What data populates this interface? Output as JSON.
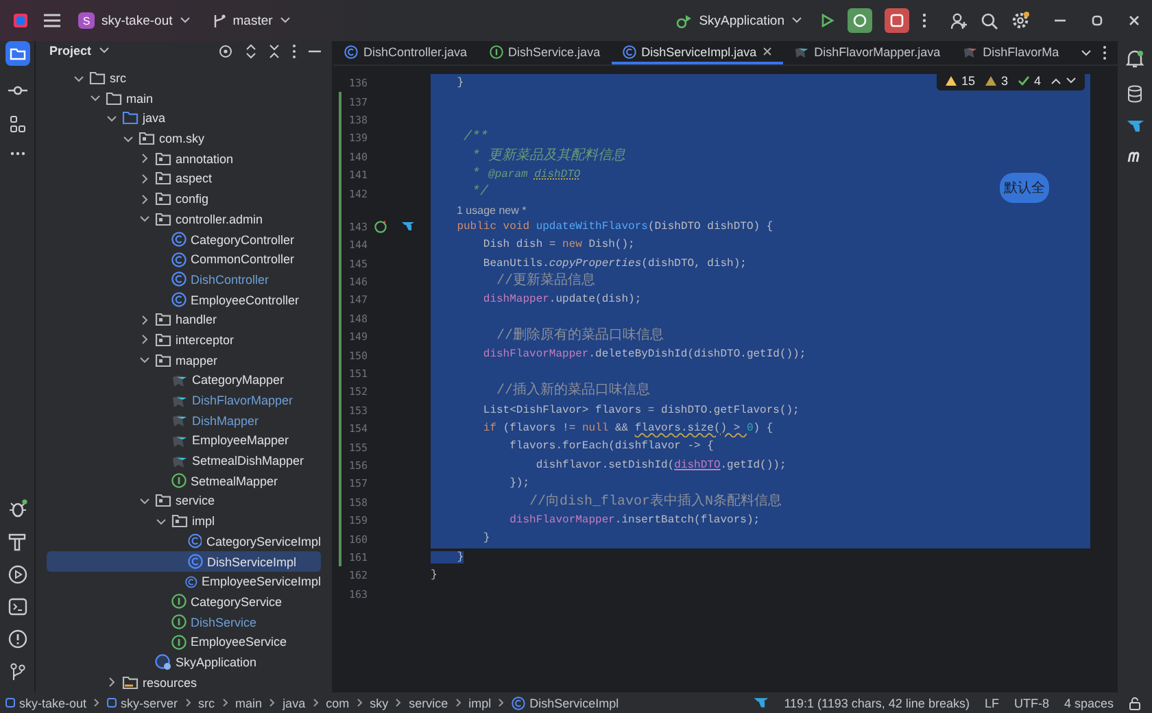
{
  "toolbar": {
    "project_badge": "S",
    "project": "sky-take-out",
    "branch": "master",
    "run_config": "SkyApplication"
  },
  "project_panel": {
    "title": "Project"
  },
  "tree": [
    {
      "label": "src",
      "kind": "folder",
      "expanded": true,
      "modified": false,
      "selected": false,
      "children": [
        {
          "label": "main",
          "kind": "folder",
          "expanded": true,
          "modified": false,
          "selected": false,
          "children": [
            {
              "label": "java",
              "kind": "source",
              "expanded": true,
              "modified": false,
              "selected": false,
              "children": [
                {
                  "label": "com.sky",
                  "kind": "package",
                  "expanded": true,
                  "modified": false,
                  "selected": false,
                  "children": [
                    {
                      "label": "annotation",
                      "kind": "package",
                      "expanded": false,
                      "modified": false,
                      "selected": false
                    },
                    {
                      "label": "aspect",
                      "kind": "package",
                      "expanded": false,
                      "modified": false,
                      "selected": false
                    },
                    {
                      "label": "config",
                      "kind": "package",
                      "expanded": false,
                      "modified": false,
                      "selected": false
                    },
                    {
                      "label": "controller.admin",
                      "kind": "package",
                      "expanded": true,
                      "modified": false,
                      "selected": false,
                      "children": [
                        {
                          "label": "CategoryController",
                          "kind": "class",
                          "modified": false,
                          "selected": false
                        },
                        {
                          "label": "CommonController",
                          "kind": "class",
                          "modified": false,
                          "selected": false
                        },
                        {
                          "label": "DishController",
                          "kind": "class",
                          "modified": true,
                          "selected": false
                        },
                        {
                          "label": "EmployeeController",
                          "kind": "class",
                          "modified": false,
                          "selected": false
                        }
                      ]
                    },
                    {
                      "label": "handler",
                      "kind": "package",
                      "expanded": false,
                      "modified": false,
                      "selected": false
                    },
                    {
                      "label": "interceptor",
                      "kind": "package",
                      "expanded": false,
                      "modified": false,
                      "selected": false
                    },
                    {
                      "label": "mapper",
                      "kind": "package",
                      "expanded": true,
                      "modified": false,
                      "selected": false,
                      "children": [
                        {
                          "label": "CategoryMapper",
                          "kind": "mapper",
                          "modified": false,
                          "selected": false
                        },
                        {
                          "label": "DishFlavorMapper",
                          "kind": "mapper",
                          "modified": true,
                          "selected": false
                        },
                        {
                          "label": "DishMapper",
                          "kind": "mapper",
                          "modified": true,
                          "selected": false
                        },
                        {
                          "label": "EmployeeMapper",
                          "kind": "mapper",
                          "modified": false,
                          "selected": false
                        },
                        {
                          "label": "SetmealDishMapper",
                          "kind": "mapper",
                          "modified": false,
                          "selected": false
                        },
                        {
                          "label": "SetmealMapper",
                          "kind": "interface",
                          "modified": false,
                          "selected": false
                        }
                      ]
                    },
                    {
                      "label": "service",
                      "kind": "package",
                      "expanded": true,
                      "modified": false,
                      "selected": false,
                      "children": [
                        {
                          "label": "impl",
                          "kind": "package",
                          "expanded": true,
                          "modified": false,
                          "selected": false,
                          "children": [
                            {
                              "label": "CategoryServiceImpl",
                              "kind": "class",
                              "modified": false,
                              "selected": false
                            },
                            {
                              "label": "DishServiceImpl",
                              "kind": "class",
                              "modified": false,
                              "selected": true
                            },
                            {
                              "label": "EmployeeServiceImpl",
                              "kind": "class",
                              "modified": false,
                              "selected": false
                            }
                          ]
                        },
                        {
                          "label": "CategoryService",
                          "kind": "interface",
                          "modified": false,
                          "selected": false
                        },
                        {
                          "label": "DishService",
                          "kind": "interface",
                          "modified": true,
                          "selected": false
                        },
                        {
                          "label": "EmployeeService",
                          "kind": "interface",
                          "modified": false,
                          "selected": false
                        }
                      ]
                    },
                    {
                      "label": "SkyApplication",
                      "kind": "app",
                      "modified": false,
                      "selected": false
                    }
                  ]
                }
              ]
            },
            {
              "label": "resources",
              "kind": "resources",
              "expanded": false,
              "modified": false,
              "selected": false
            }
          ]
        }
      ]
    }
  ],
  "tabs": [
    {
      "label": "DishController.java",
      "kind": "class",
      "selected": false,
      "closable": false
    },
    {
      "label": "DishService.java",
      "kind": "interface",
      "selected": false,
      "closable": false
    },
    {
      "label": "DishServiceImpl.java",
      "kind": "class",
      "selected": true,
      "closable": true
    },
    {
      "label": "DishFlavorMapper.java",
      "kind": "mapper",
      "selected": false,
      "closable": false
    },
    {
      "label": "DishFlavorMa",
      "kind": "mapper-xml",
      "selected": false,
      "closable": false
    }
  ],
  "inspections": [
    {
      "kind": "warning",
      "count": "15"
    },
    {
      "kind": "weak",
      "count": "3"
    },
    {
      "kind": "ok",
      "count": "4"
    }
  ],
  "hint_bubble": "默认全",
  "lines": [
    {
      "kind": "code",
      "number": "136",
      "selected": true,
      "changed": false,
      "tokens": [
        {
          "kind": "plain",
          "text": "    }"
        }
      ]
    },
    {
      "kind": "code",
      "number": "137",
      "selected": true,
      "changed": true
    },
    {
      "kind": "code",
      "number": "138",
      "selected": true,
      "changed": true
    },
    {
      "kind": "code",
      "number": "139",
      "selected": true,
      "changed": true,
      "tokens": [
        {
          "kind": "doc",
          "text": "    /**"
        }
      ]
    },
    {
      "kind": "code",
      "number": "140",
      "selected": true,
      "changed": true,
      "tokens": [
        {
          "kind": "doc",
          "text": "     * 更新菜品及其配料信息"
        }
      ]
    },
    {
      "kind": "code",
      "number": "141",
      "selected": true,
      "changed": true,
      "tokens": [
        {
          "kind": "doc",
          "text": "     * "
        },
        {
          "kind": "doctag",
          "text": "@param "
        },
        {
          "kind": "docref",
          "text": "dishDTO"
        }
      ]
    },
    {
      "kind": "code",
      "number": "142",
      "selected": true,
      "changed": true,
      "tokens": [
        {
          "kind": "doc",
          "text": "     */"
        }
      ]
    },
    {
      "kind": "inlay",
      "text": "1 usage   new *",
      "selected": true,
      "changed": true
    },
    {
      "kind": "code",
      "number": "143",
      "selected": true,
      "changed": true,
      "gutter_icons": true,
      "tokens": [
        {
          "kind": "kw",
          "text": "    public void "
        },
        {
          "kind": "fn",
          "text": "updateWithFlavors"
        },
        {
          "kind": "plain",
          "text": "(DishDTO dishDTO) {"
        }
      ]
    },
    {
      "kind": "code",
      "number": "144",
      "selected": true,
      "changed": true,
      "tokens": [
        {
          "kind": "plain",
          "text": "        Dish dish = "
        },
        {
          "kind": "kw",
          "text": "new"
        },
        {
          "kind": "plain",
          "text": " Dish();"
        }
      ]
    },
    {
      "kind": "code",
      "number": "145",
      "selected": true,
      "changed": true,
      "tokens": [
        {
          "kind": "plain",
          "text": "        BeanUtils."
        },
        {
          "kind": "static",
          "text": "copyProperties"
        },
        {
          "kind": "plain",
          "text": "(dishDTO, dish);"
        }
      ]
    },
    {
      "kind": "code",
      "number": "146",
      "selected": true,
      "changed": true,
      "tokens": [
        {
          "kind": "comment",
          "text": "        //更新菜品信息"
        }
      ]
    },
    {
      "kind": "code",
      "number": "147",
      "selected": true,
      "changed": true,
      "tokens": [
        {
          "kind": "field",
          "text": "        dishMapper"
        },
        {
          "kind": "plain",
          "text": ".update(dish);"
        }
      ]
    },
    {
      "kind": "code",
      "number": "148",
      "selected": true,
      "changed": true
    },
    {
      "kind": "code",
      "number": "149",
      "selected": true,
      "changed": true,
      "tokens": [
        {
          "kind": "comment",
          "text": "        //删除原有的菜品口味信息"
        }
      ]
    },
    {
      "kind": "code",
      "number": "150",
      "selected": true,
      "changed": true,
      "tokens": [
        {
          "kind": "field",
          "text": "        dishFlavorMapper"
        },
        {
          "kind": "plain",
          "text": ".deleteByDishId(dishDTO.getId());"
        }
      ]
    },
    {
      "kind": "code",
      "number": "151",
      "selected": true,
      "changed": true
    },
    {
      "kind": "code",
      "number": "152",
      "selected": true,
      "changed": true,
      "tokens": [
        {
          "kind": "comment",
          "text": "        //插入新的菜品口味信息"
        }
      ]
    },
    {
      "kind": "code",
      "number": "153",
      "selected": true,
      "changed": true,
      "tokens": [
        {
          "kind": "plain",
          "text": "        List<DishFlavor> flavors = dishDTO.getFlavors();"
        }
      ]
    },
    {
      "kind": "code",
      "number": "154",
      "selected": true,
      "changed": true,
      "tokens": [
        {
          "kind": "kw",
          "text": "        if"
        },
        {
          "kind": "plain",
          "text": " (flavors != "
        },
        {
          "kind": "kw",
          "text": "null"
        },
        {
          "kind": "plain",
          "text": " && "
        },
        {
          "kind": "warn",
          "text": "flavors.size() > "
        },
        {
          "kind": "num",
          "text": "0"
        },
        {
          "kind": "plain",
          "text": ") {"
        }
      ]
    },
    {
      "kind": "code",
      "number": "155",
      "selected": true,
      "changed": true,
      "tokens": [
        {
          "kind": "plain",
          "text": "            flavors.forEach(dishflavor -> {"
        }
      ]
    },
    {
      "kind": "code",
      "number": "156",
      "selected": true,
      "changed": true,
      "tokens": [
        {
          "kind": "plain",
          "text": "                dishflavor.setDishId("
        },
        {
          "kind": "captured",
          "text": "dishDTO"
        },
        {
          "kind": "plain",
          "text": ".getId());"
        }
      ]
    },
    {
      "kind": "code",
      "number": "157",
      "selected": true,
      "changed": true,
      "tokens": [
        {
          "kind": "plain",
          "text": "            });"
        }
      ]
    },
    {
      "kind": "code",
      "number": "158",
      "selected": true,
      "changed": true,
      "tokens": [
        {
          "kind": "comment",
          "text": "            //向dish_flavor表中插入N条配料信息"
        }
      ]
    },
    {
      "kind": "code",
      "number": "159",
      "selected": true,
      "changed": true,
      "tokens": [
        {
          "kind": "field",
          "text": "            dishFlavorMapper"
        },
        {
          "kind": "plain",
          "text": ".insertBatch(flavors);"
        }
      ]
    },
    {
      "kind": "code",
      "number": "160",
      "selected": true,
      "changed": true,
      "tokens": [
        {
          "kind": "plain",
          "text": "        }"
        }
      ]
    },
    {
      "kind": "code",
      "number": "161",
      "selected": false,
      "changed": true,
      "tokens": [
        {
          "kind": "plain",
          "text": "    }",
          "selected": true
        }
      ]
    },
    {
      "kind": "code",
      "number": "162",
      "selected": false,
      "changed": false,
      "tokens": [
        {
          "kind": "plain",
          "text": "}"
        }
      ]
    },
    {
      "kind": "code",
      "number": "163",
      "selected": false,
      "changed": false
    }
  ],
  "breadcrumbs": [
    {
      "label": "sky-take-out",
      "kind": "module"
    },
    {
      "label": "sky-server",
      "kind": "module"
    },
    {
      "label": "src",
      "kind": "folder"
    },
    {
      "label": "main",
      "kind": "folder"
    },
    {
      "label": "java",
      "kind": "folder"
    },
    {
      "label": "com",
      "kind": "folder"
    },
    {
      "label": "sky",
      "kind": "folder"
    },
    {
      "label": "service",
      "kind": "folder"
    },
    {
      "label": "impl",
      "kind": "folder"
    },
    {
      "label": "DishServiceImpl",
      "kind": "class"
    }
  ],
  "status": {
    "position": "119:1 (1193 chars, 42 line breaks)",
    "line_separator": "LF",
    "encoding": "UTF-8",
    "indent": "4 spaces"
  }
}
